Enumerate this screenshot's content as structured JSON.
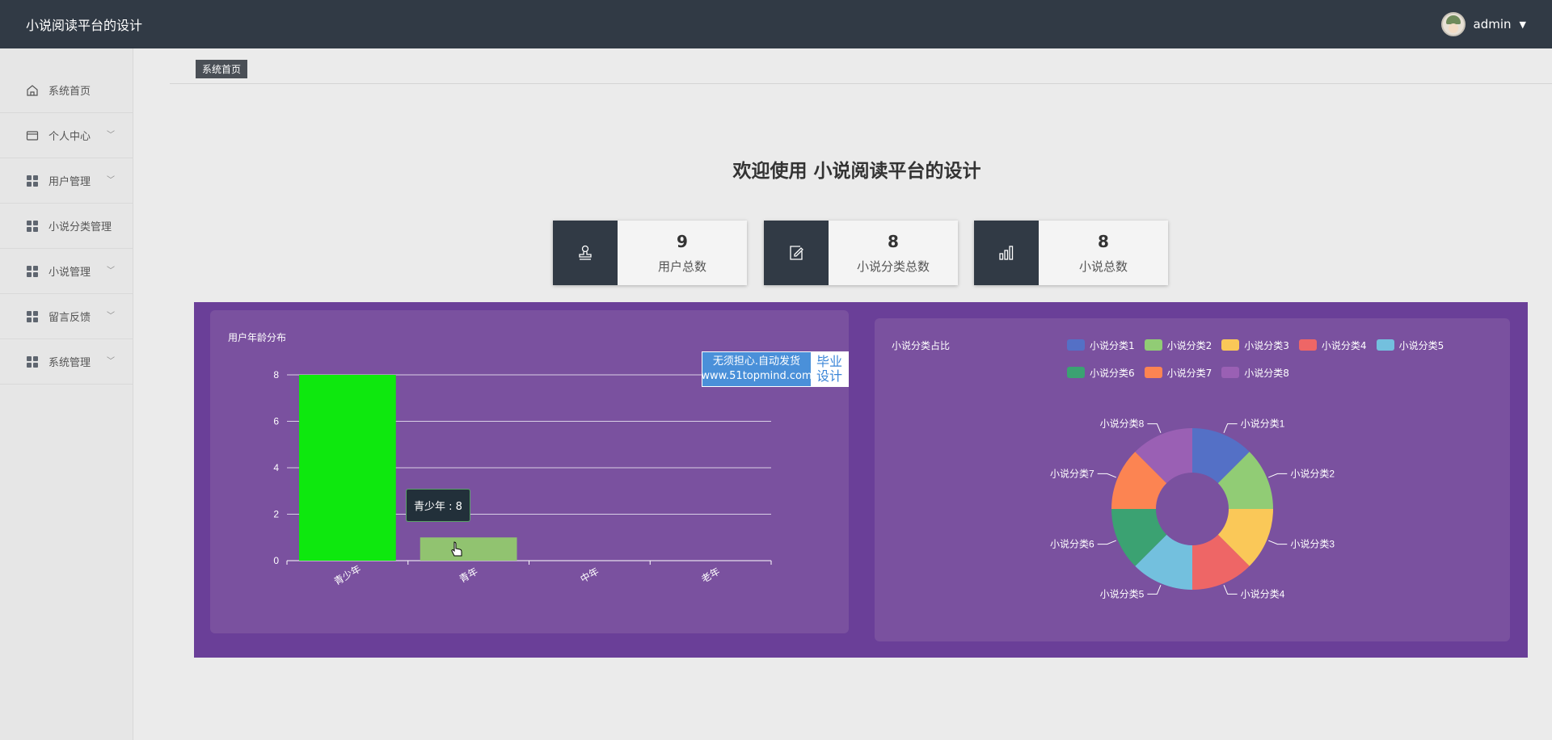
{
  "header": {
    "title": "小说阅读平台的设计",
    "user": "admin"
  },
  "sidebar": {
    "items": [
      {
        "label": "系统首页",
        "icon": "home-icon",
        "expandable": false
      },
      {
        "label": "个人中心",
        "icon": "card-icon",
        "expandable": true
      },
      {
        "label": "用户管理",
        "icon": "grid-icon",
        "expandable": true
      },
      {
        "label": "小说分类管理",
        "icon": "grid-icon",
        "expandable": false
      },
      {
        "label": "小说管理",
        "icon": "grid-icon",
        "expandable": true
      },
      {
        "label": "留言反馈",
        "icon": "grid-icon",
        "expandable": true
      },
      {
        "label": "系统管理",
        "icon": "grid-icon",
        "expandable": true
      }
    ]
  },
  "breadcrumb": {
    "current": "系统首页"
  },
  "welcome": "欢迎使用 小说阅读平台的设计",
  "stats": [
    {
      "value": "9",
      "label": "用户总数",
      "icon": "stamp-icon"
    },
    {
      "value": "8",
      "label": "小说分类总数",
      "icon": "edit-icon"
    },
    {
      "value": "8",
      "label": "小说总数",
      "icon": "bar-chart-icon"
    }
  ],
  "ad": {
    "line1": "无须担心.自动发货",
    "line2": "www.51topmind.com",
    "tag1": "毕业",
    "tag2": "设计"
  },
  "tooltip": "青少年 : 8",
  "colors": {
    "topbar": "#313a45",
    "purple_bg": "#6a3f98",
    "panel": "#7a519f",
    "bar_highlight": "#0ee80e",
    "bar_normal": "#91c370"
  },
  "chart_data": [
    {
      "type": "bar",
      "title": "用户年龄分布",
      "categories": [
        "青少年",
        "青年",
        "中年",
        "老年"
      ],
      "values": [
        8,
        1,
        0,
        0
      ],
      "ylim": [
        0,
        8
      ],
      "yticks": [
        "0",
        "2",
        "4",
        "6",
        "8"
      ],
      "grid": true
    },
    {
      "type": "pie",
      "title": "小说分类占比",
      "donut": true,
      "labels": [
        "小说分类1",
        "小说分类2",
        "小说分类3",
        "小说分类4",
        "小说分类5",
        "小说分类6",
        "小说分类7",
        "小说分类8"
      ],
      "values": [
        1,
        1,
        1,
        1,
        1,
        1,
        1,
        1
      ],
      "colors": [
        "#5470c6",
        "#91cc75",
        "#fac858",
        "#ee6666",
        "#73c0de",
        "#3ba272",
        "#fc8452",
        "#9a60b4"
      ],
      "legend": "top-right"
    }
  ]
}
